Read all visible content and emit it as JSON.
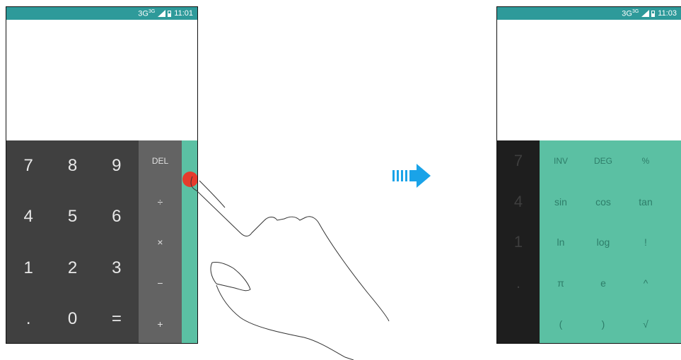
{
  "left_phone": {
    "status": {
      "network": "3G",
      "network_sup": "3G",
      "time": "11:01"
    },
    "numpad": [
      "7",
      "8",
      "9",
      "4",
      "5",
      "6",
      "1",
      "2",
      "3",
      ".",
      "0",
      "="
    ],
    "operators": [
      "DEL",
      "÷",
      "×",
      "−",
      "+"
    ]
  },
  "right_phone": {
    "status": {
      "network": "3G",
      "network_sup": "3G",
      "time": "11:03"
    },
    "numpad_dimmed": [
      "7",
      "4",
      "1",
      "."
    ],
    "advanced": [
      "INV",
      "DEG",
      "%",
      "sin",
      "cos",
      "tan",
      "ln",
      "log",
      "!",
      "π",
      "e",
      "^",
      "(",
      ")",
      "√"
    ]
  },
  "colors": {
    "status_bar": "#2e9a9a",
    "numpad_bg": "#404040",
    "operator_bg": "#636363",
    "advanced_bg": "#5bc0a3",
    "touch_indicator": "#e53b2c",
    "arrow": "#1aa3e8"
  },
  "icons": [
    "signal-icon",
    "battery-icon",
    "swipe-arrow-icon",
    "hand-gesture-icon"
  ]
}
